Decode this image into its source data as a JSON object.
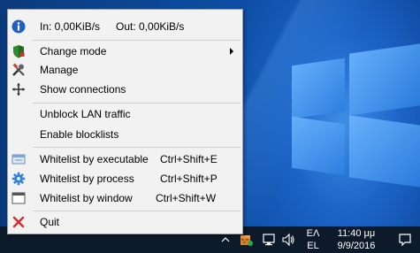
{
  "menu": {
    "status": {
      "in": "In: 0,00KiB/s",
      "out": "Out: 0,00KiB/s"
    },
    "change_mode": "Change mode",
    "manage": "Manage",
    "show_connections": "Show connections",
    "unblock_lan": "Unblock LAN traffic",
    "enable_blocklists": "Enable blocklists",
    "wl_executable": {
      "label": "Whitelist by executable",
      "shortcut": "Ctrl+Shift+E"
    },
    "wl_process": {
      "label": "Whitelist by process",
      "shortcut": "Ctrl+Shift+P"
    },
    "wl_window": {
      "label": "Whitelist by window",
      "shortcut": "Ctrl+Shift+W"
    },
    "quit": "Quit"
  },
  "taskbar": {
    "language_top": "ΕΛ",
    "language_bottom": "EL",
    "time": "11:40 μμ",
    "date": "9/9/2016"
  },
  "icons": {
    "info": "info-icon",
    "shield": "shield-icon",
    "tools": "tools-icon",
    "connections": "connections-icon",
    "executable": "executable-icon",
    "process": "gear-icon",
    "window": "window-icon",
    "quit": "close-icon"
  }
}
